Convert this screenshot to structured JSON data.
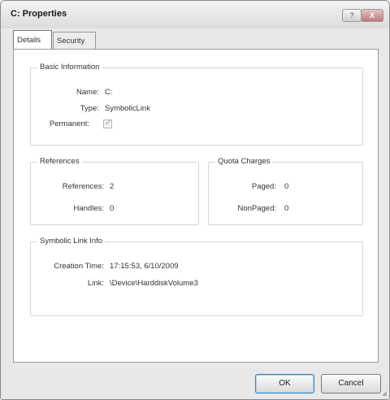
{
  "window": {
    "title": "C: Properties",
    "help_label": "?",
    "close_label": "X"
  },
  "tabs": [
    {
      "label": "Details",
      "active": true
    },
    {
      "label": "Security",
      "active": false
    }
  ],
  "basic_info": {
    "heading": "Basic Information",
    "name_label": "Name:",
    "name_value": "C:",
    "type_label": "Type:",
    "type_value": "SymbolicLink",
    "permanent_label": "Permanent:",
    "permanent_checked": true,
    "permanent_check_glyph": "✓"
  },
  "references": {
    "heading": "References",
    "references_label": "References:",
    "references_value": "2",
    "handles_label": "Handles:",
    "handles_value": "0"
  },
  "quota": {
    "heading": "Quota Charges",
    "paged_label": "Paged:",
    "paged_value": "0",
    "nonpaged_label": "NonPaged:",
    "nonpaged_value": "0"
  },
  "symlink": {
    "heading": "Symbolic Link Info",
    "creation_label": "Creation Time:",
    "creation_value": "17:15:53, 6/10/2009",
    "link_label": "Link:",
    "link_value": "\\Device\\HarddiskVolume3"
  },
  "buttons": {
    "ok": "OK",
    "cancel": "Cancel"
  }
}
